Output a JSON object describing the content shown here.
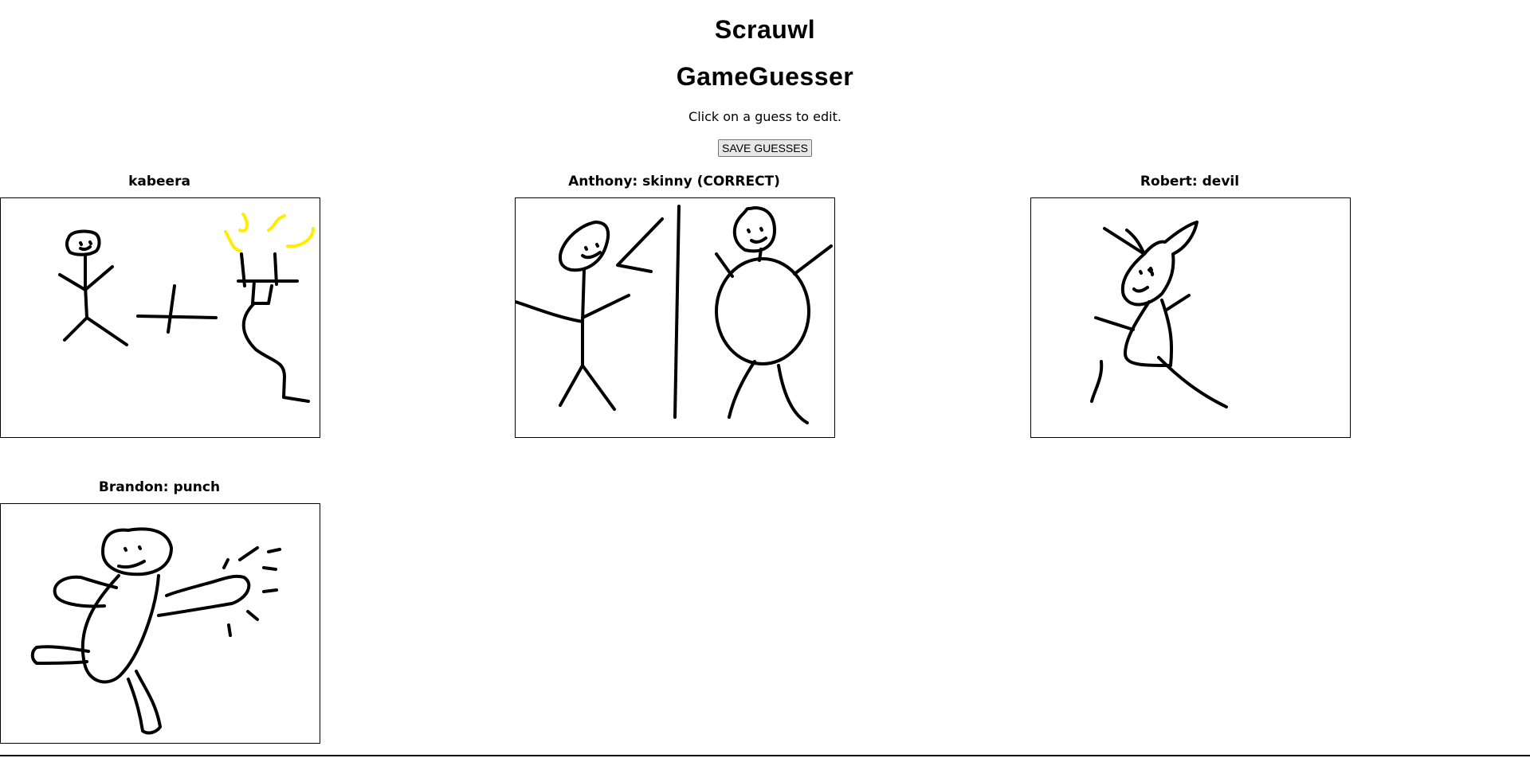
{
  "header": {
    "app_title": "Scrauwl",
    "page_title": "GameGuesser",
    "instructions": "Click on a guess to edit.",
    "save_label": "SAVE GUESSES"
  },
  "drawings": [
    {
      "label": "kabeera",
      "pen_colors": [
        "#000000",
        "#ffee00"
      ]
    },
    {
      "label": "Anthony: skinny (CORRECT)",
      "pen_colors": [
        "#000000"
      ]
    },
    {
      "label": "Robert: devil",
      "pen_colors": [
        "#000000"
      ]
    },
    {
      "label": "Brandon: punch",
      "pen_colors": [
        "#000000"
      ]
    }
  ]
}
